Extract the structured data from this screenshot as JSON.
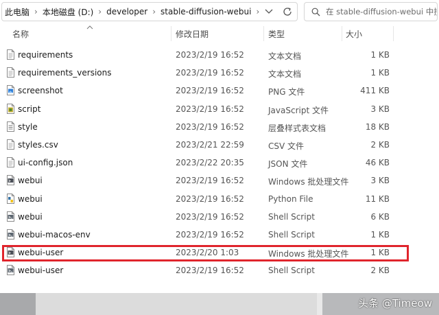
{
  "breadcrumb": {
    "items": [
      "此电脑",
      "本地磁盘 (D:)",
      "developer",
      "stable-diffusion-webui"
    ],
    "separator": "›"
  },
  "search": {
    "placeholder": "在 stable-diffusion-webui 中搜索"
  },
  "columns": {
    "name": "名称",
    "date": "修改日期",
    "type": "类型",
    "size": "大小"
  },
  "files": [
    {
      "name": "requirements",
      "date": "2023/2/19 16:52",
      "type": "文本文档",
      "size": "1 KB",
      "icon": "text-file-icon"
    },
    {
      "name": "requirements_versions",
      "date": "2023/2/19 16:52",
      "type": "文本文档",
      "size": "1 KB",
      "icon": "text-file-icon"
    },
    {
      "name": "screenshot",
      "date": "2023/2/19 16:52",
      "type": "PNG 文件",
      "size": "411 KB",
      "icon": "png-file-icon"
    },
    {
      "name": "script",
      "date": "2023/2/19 16:52",
      "type": "JavaScript 文件",
      "size": "3 KB",
      "icon": "javascript-file-icon"
    },
    {
      "name": "style",
      "date": "2023/2/19 16:52",
      "type": "层叠样式表文档",
      "size": "18 KB",
      "icon": "css-file-icon"
    },
    {
      "name": "styles.csv",
      "date": "2023/2/21 22:59",
      "type": "CSV 文件",
      "size": "2 KB",
      "icon": "csv-file-icon"
    },
    {
      "name": "ui-config.json",
      "date": "2023/2/22 20:35",
      "type": "JSON 文件",
      "size": "46 KB",
      "icon": "json-file-icon"
    },
    {
      "name": "webui",
      "date": "2023/2/19 16:52",
      "type": "Windows 批处理文件",
      "size": "3 KB",
      "icon": "batch-file-icon"
    },
    {
      "name": "webui",
      "date": "2023/2/19 16:52",
      "type": "Python File",
      "size": "11 KB",
      "icon": "python-file-icon"
    },
    {
      "name": "webui",
      "date": "2023/2/19 16:52",
      "type": "Shell Script",
      "size": "6 KB",
      "icon": "shell-script-icon"
    },
    {
      "name": "webui-macos-env",
      "date": "2023/2/19 16:52",
      "type": "Shell Script",
      "size": "1 KB",
      "icon": "shell-script-icon"
    },
    {
      "name": "webui-user",
      "date": "2023/2/20 1:03",
      "type": "Windows 批处理文件",
      "size": "1 KB",
      "icon": "batch-file-icon",
      "highlighted": true
    },
    {
      "name": "webui-user",
      "date": "2023/2/19 16:52",
      "type": "Shell Script",
      "size": "2 KB",
      "icon": "shell-script-icon"
    }
  ],
  "watermark": "头条 @Timeow",
  "colors": {
    "highlight": "#e0242c"
  }
}
